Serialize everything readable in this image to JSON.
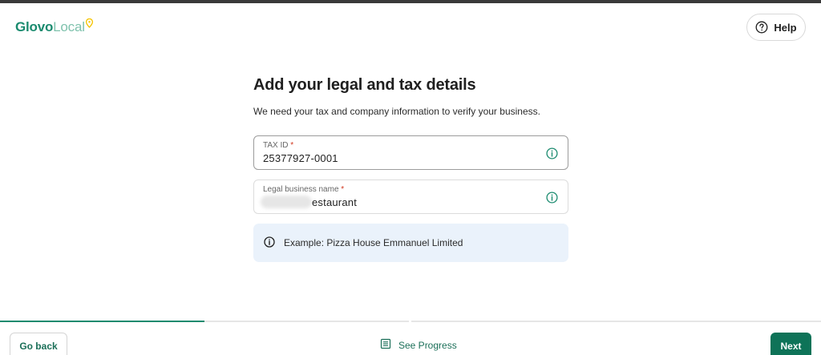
{
  "brand": {
    "part1": "Glovo",
    "part2": "Local",
    "accent": "#1b8b6f"
  },
  "header": {
    "help_label": "Help"
  },
  "main": {
    "title": "Add your legal and tax details",
    "subtitle": "We need your tax and company information to verify your business."
  },
  "fields": {
    "tax_id": {
      "label": "TAX ID",
      "required_mark": "*",
      "value": "25377927-0001"
    },
    "legal_name": {
      "label": "Legal business name",
      "required_mark": "*",
      "value": "estaurant"
    }
  },
  "hint": {
    "text": "Example: Pizza House Emmanuel Limited"
  },
  "footer": {
    "back_label": "Go back",
    "progress_label": "See Progress",
    "next_label": "Next"
  },
  "colors": {
    "primary": "#0e7358",
    "hint_bg": "#eaf2fb",
    "required": "#d0361d"
  }
}
